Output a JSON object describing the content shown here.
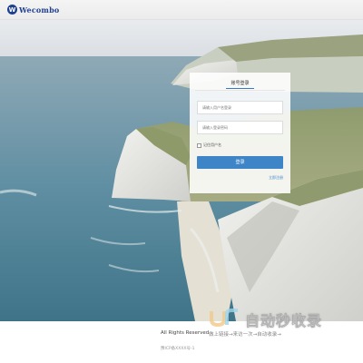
{
  "header": {
    "logo_text": "Wecombo",
    "logo_glyph": "W",
    "brand_color": "#1f3f8f"
  },
  "login": {
    "tab_label": "账号登录",
    "username_placeholder": "请输入用户名登录",
    "password_placeholder": "请输入登录密码",
    "remember_label": "记住用户名",
    "remember_checked": false,
    "login_button": "登录",
    "register_link": "立即注册",
    "accent_color": "#3d85c6"
  },
  "footer": {
    "rights": "All Rights Reserved",
    "icp": "豫ICP备XXXX号-1"
  },
  "watermark": {
    "title": "自动秒收录",
    "slogan": "做上链接→来访一次→自动收录→"
  }
}
